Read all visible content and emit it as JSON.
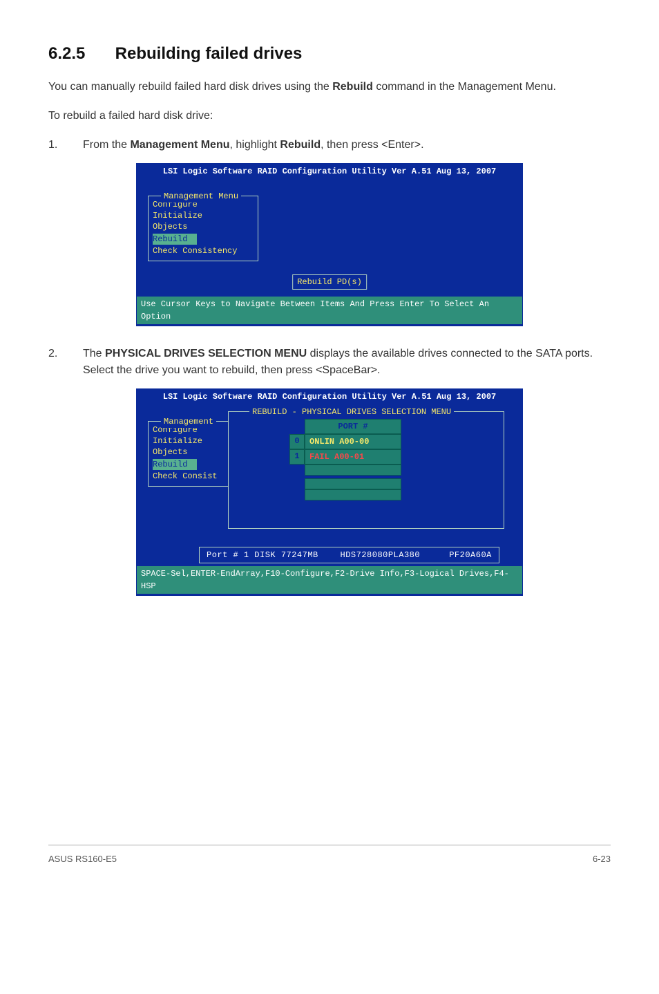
{
  "section": {
    "number": "6.2.5",
    "title": "Rebuilding failed drives"
  },
  "intro": {
    "before_bold": "You can manually rebuild failed hard disk drives using the ",
    "bold": "Rebuild",
    "after_bold": " command in the Management Menu."
  },
  "subintro": "To rebuild a failed hard disk drive:",
  "steps": [
    {
      "num": "1.",
      "segments": {
        "a": "From the ",
        "b": "Management Menu",
        "c": ", highlight ",
        "d": "Rebuild",
        "e": ", then press <Enter>."
      }
    },
    {
      "num": "2.",
      "segments": {
        "a": "The ",
        "b": "PHYSICAL DRIVES SELECTION MENU",
        "c": " displays the available drives connected to the SATA ports. Select the drive you want to rebuild, then press <SpaceBar>."
      }
    }
  ],
  "term1": {
    "title": "LSI Logic Software RAID Configuration Utility Ver A.51 Aug 13, 2007",
    "menu_legend": "Management Menu",
    "menu_items": [
      "Configure",
      "Initialize",
      "Objects",
      "Rebuild",
      "Check Consistency"
    ],
    "selected_index": 3,
    "action_box": "Rebuild PD(s)",
    "footer": "Use Cursor Keys to Navigate Between Items And Press Enter To Select An Option"
  },
  "term2": {
    "title": "LSI Logic Software RAID Configuration Utility Ver A.51 Aug 13, 2007",
    "menu_legend": "Management",
    "menu_items": [
      "Configure",
      "Initialize",
      "Objects",
      "Rebuild",
      "Check Consist"
    ],
    "selected_index": 3,
    "selection_legend": "REBUILD - PHYSICAL DRIVES SELECTION MENU",
    "drive_header": "PORT #",
    "drives": [
      {
        "idx": "0",
        "label": "ONLIN A00-00",
        "selected": false
      },
      {
        "idx": "1",
        "label": "FAIL  A00-01",
        "selected": true
      }
    ],
    "port_info": {
      "name": "Port # 1 DISK",
      "size": "77247MB",
      "model": "HDS728080PLA380",
      "rev": "PF20A60A"
    },
    "footer": "SPACE-Sel,ENTER-EndArray,F10-Configure,F2-Drive Info,F3-Logical Drives,F4-HSP"
  },
  "footer": {
    "left": "ASUS RS160-E5",
    "right": "6-23"
  }
}
